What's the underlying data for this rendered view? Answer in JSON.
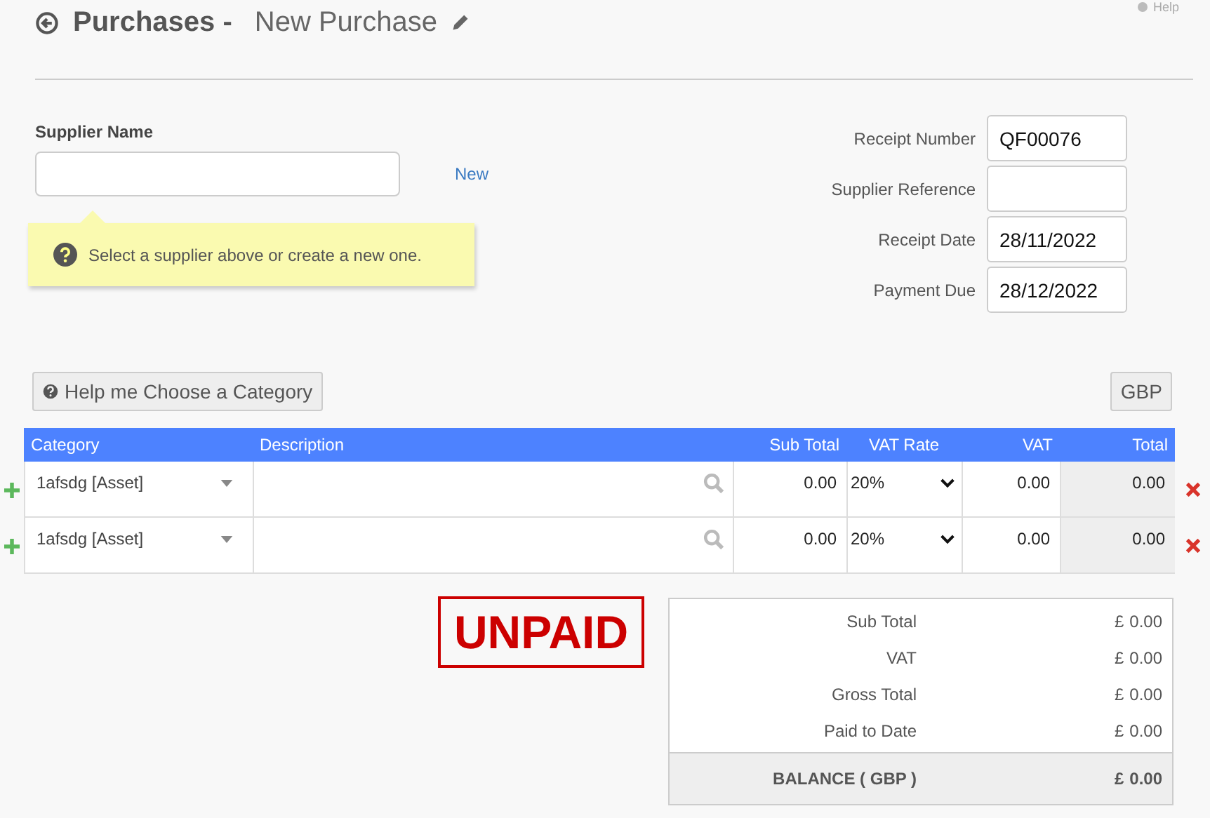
{
  "header": {
    "title": "Purchases -",
    "subtitle": "New Purchase",
    "help_link": "Help"
  },
  "supplier": {
    "label": "Supplier Name",
    "new_link": "New",
    "hint": "Select a supplier above or create a new one."
  },
  "fields": [
    {
      "label": "Receipt Number",
      "value": "QF00076"
    },
    {
      "label": "Supplier Reference"
    },
    {
      "label": "Receipt Date",
      "value": "28/11/2022"
    },
    {
      "label": "Payment Due",
      "value": "28/12/2022"
    }
  ],
  "category_help_button": "Help me Choose a Category",
  "currency_button": "GBP",
  "table": {
    "columns": [
      "Category",
      "Description",
      "Sub Total",
      "VAT Rate",
      "VAT",
      "Total"
    ],
    "rows": [
      {
        "category": "1afsdg [Asset]",
        "sub_total": "0.00",
        "vat_rate": "20%",
        "vat": "0.00",
        "total": "0.00"
      },
      {
        "category": "1afsdg [Asset]",
        "sub_total": "0.00",
        "vat_rate": "20%",
        "vat": "0.00",
        "total": "0.00"
      }
    ]
  },
  "status_stamp": "UNPAID",
  "summary": {
    "rows": [
      {
        "label": "Sub Total",
        "currency": "£",
        "amount": "0.00"
      },
      {
        "label": "VAT",
        "currency": "£",
        "amount": "0.00"
      },
      {
        "label": "Gross Total",
        "currency": "£",
        "amount": "0.00"
      },
      {
        "label": "Paid to Date",
        "currency": "£",
        "amount": "0.00"
      }
    ],
    "balance": {
      "label": "BALANCE ( GBP )",
      "currency": "£",
      "amount": "0.00"
    }
  }
}
